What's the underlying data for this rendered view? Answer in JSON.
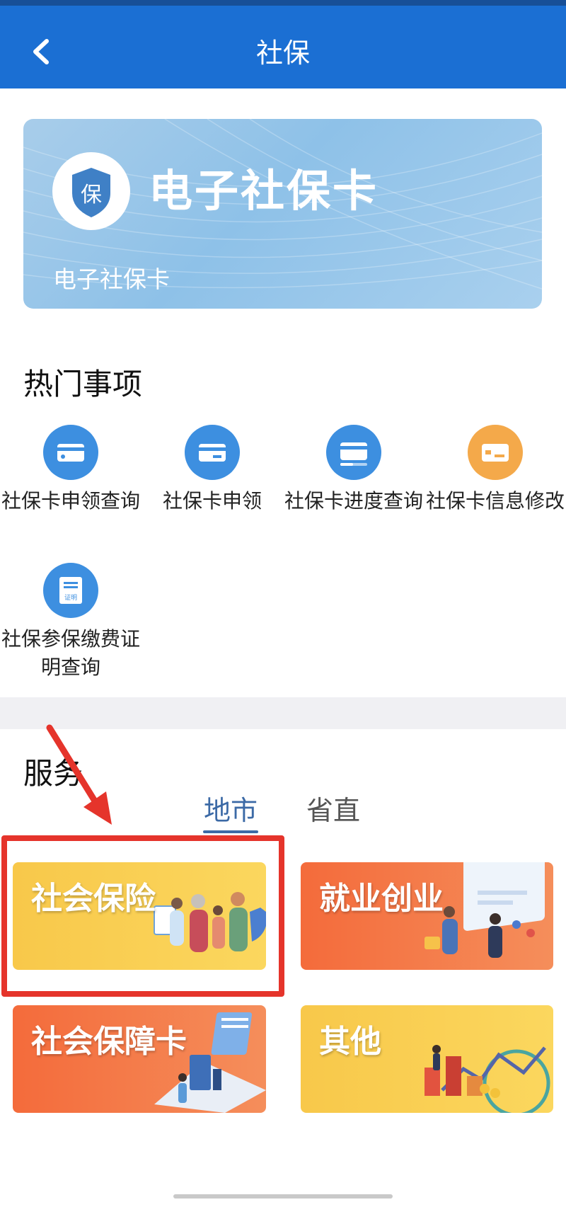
{
  "header": {
    "title": "社保",
    "back_icon": "chevron-left-icon"
  },
  "card": {
    "logo_char": "保",
    "title": "电子社保卡",
    "subtitle": "电子社保卡"
  },
  "hot": {
    "title": "热门事项",
    "items": [
      {
        "label": "社保卡申领查询",
        "icon": "card-icon",
        "color": "#3d8fe0"
      },
      {
        "label": "社保卡申领",
        "icon": "card-icon",
        "color": "#3d8fe0"
      },
      {
        "label": "社保卡进度查询",
        "icon": "card-progress-icon",
        "color": "#3d8fe0"
      },
      {
        "label": "社保卡信息修改",
        "icon": "card-icon",
        "color": "#f4a94a"
      },
      {
        "label": "社保参保缴费证明查询",
        "icon": "certificate-icon",
        "icon_text": "证明",
        "color": "#3d8fe0"
      }
    ]
  },
  "services": {
    "title": "服务",
    "tabs": [
      {
        "label": "地市",
        "active": true
      },
      {
        "label": "省直",
        "active": false
      }
    ],
    "tiles": [
      {
        "label": "社会保险",
        "style": "yellow"
      },
      {
        "label": "就业创业",
        "style": "coral"
      },
      {
        "label": "社会保障卡",
        "style": "coral"
      },
      {
        "label": "其他",
        "style": "yellow"
      }
    ]
  },
  "colors": {
    "header": "#1b6fd3",
    "accent_tab": "#3c6aa6",
    "highlight": "#e5342b"
  }
}
